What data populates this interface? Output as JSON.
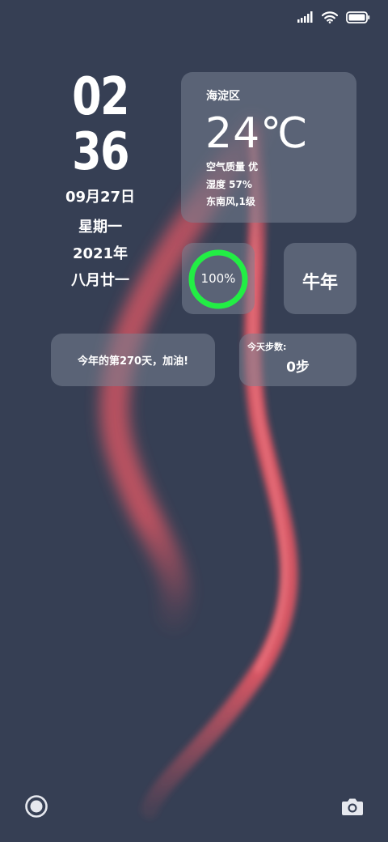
{
  "status_bar": {
    "signal_icon": "signal-bars-icon",
    "wifi_icon": "wifi-icon",
    "battery_icon": "battery-full-icon"
  },
  "clock": {
    "hour": "02",
    "minute": "36",
    "date": "09月27日",
    "weekday": "星期一",
    "year": "2021年",
    "lunar_date": "八月廿一"
  },
  "weather": {
    "district": "海淀区",
    "temperature": "24℃",
    "air_quality": "空气质量 优",
    "humidity": "湿度 57%",
    "wind": "东南风,1级"
  },
  "battery": {
    "label": "100%",
    "level": 1.0,
    "ring_color": "#22ee44"
  },
  "zodiac": {
    "label": "牛年"
  },
  "day_of_year": {
    "label": "今年的第270天，加油!"
  },
  "steps": {
    "title": "今天步数:",
    "value": "0步"
  },
  "bottom_bar": {
    "left_icon": "record-icon",
    "right_icon": "camera-icon"
  },
  "colors": {
    "background": "#363f54",
    "ribbon": "#f05a66"
  }
}
